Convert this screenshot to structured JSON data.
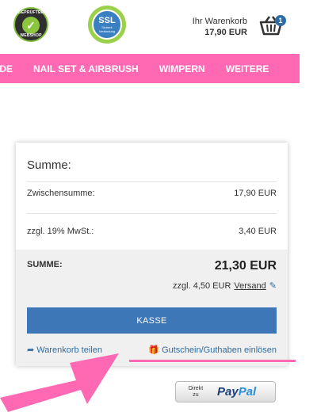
{
  "header": {
    "badge_webshop": {
      "top_text": "GEPRÜFTER",
      "bottom_text": "WEBSHOP"
    },
    "badge_ssl": {
      "title": "SSL",
      "subtitle": "Sichere Verbindung"
    },
    "cart": {
      "label": "Ihr Warenkorb",
      "total": "17,90 EUR",
      "count": "1"
    }
  },
  "nav": {
    "items": [
      "IDE",
      "NAIL SET & AIRBRUSH",
      "WIMPERN",
      "WEITERE"
    ]
  },
  "summary": {
    "title": "Summe:",
    "subtotal_label": "Zwischensumme:",
    "subtotal_value": "17,90 EUR",
    "tax_label": "zzgl. 19% MwSt.:",
    "tax_value": "3,40 EUR",
    "sum_label": "SUMME:",
    "sum_value": "21,30 EUR",
    "shipping_prefix": "zzgl. 4,50 EUR",
    "shipping_link": "Versand",
    "checkout_label": "KASSE",
    "share_label": "Warenkorb teilen",
    "voucher_label": "Gutschein/Guthaben einlösen"
  },
  "paypal": {
    "direkt": "Direkt",
    "zu": "zu",
    "pay": "Pay",
    "pal": "Pal"
  },
  "colors": {
    "accent_pink": "#ff69b4",
    "button_blue": "#3e77b7",
    "link_blue": "#2e6da4"
  }
}
